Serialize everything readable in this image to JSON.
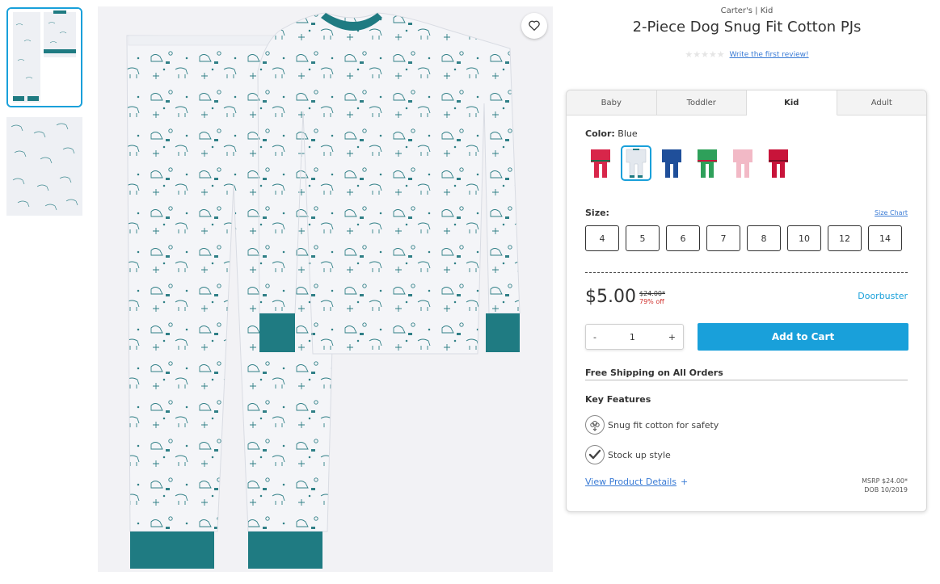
{
  "product": {
    "brand": "Carter's | Kid",
    "title": "2-Piece Dog Snug Fit Cotton PJs",
    "rating_stars": "★★★★★",
    "review_link": "Write the first review!"
  },
  "gallery": {
    "thumbnails": [
      "pajama-set-thumbnail",
      "fabric-detail-thumbnail"
    ],
    "fav_icon": "heart-icon"
  },
  "tabs": [
    {
      "label": "Baby",
      "active": false
    },
    {
      "label": "Toddler",
      "active": false
    },
    {
      "label": "Kid",
      "active": true
    },
    {
      "label": "Adult",
      "active": false
    }
  ],
  "color": {
    "label": "Color:",
    "value": "Blue",
    "swatches": [
      {
        "name": "red-print",
        "color": "#d8264a",
        "selected": false
      },
      {
        "name": "blue-dog",
        "color": "#e8edf2",
        "selected": true
      },
      {
        "name": "navy",
        "color": "#1f4f9a",
        "selected": false
      },
      {
        "name": "green",
        "color": "#2ea05a",
        "selected": false
      },
      {
        "name": "pink",
        "color": "#f2b9c6",
        "selected": false
      },
      {
        "name": "red",
        "color": "#c8143a",
        "selected": false
      }
    ]
  },
  "size": {
    "label": "Size:",
    "chart_link": "Size Chart",
    "options": [
      "4",
      "5",
      "6",
      "7",
      "8",
      "10",
      "12",
      "14"
    ]
  },
  "price": {
    "current": "$5.00",
    "original": "$24.00*",
    "discount": "79% off",
    "badge": "Doorbuster"
  },
  "cart": {
    "minus": "-",
    "quantity": "1",
    "plus": "+",
    "add_label": "Add to Cart"
  },
  "shipping": "Free Shipping on All Orders",
  "features": {
    "title": "Key Features",
    "items": [
      {
        "label": "Snug fit cotton for safety",
        "icon": "cotton-flower-icon"
      },
      {
        "label": "Stock up style",
        "icon": "checkmark-icon"
      }
    ]
  },
  "details": {
    "link": "View Product Details",
    "plus": "+",
    "msrp": "MSRP $24.00*",
    "dob": "DOB 10/2019"
  },
  "colors": {
    "accent": "#19a0da",
    "link": "#3a7bd5",
    "sale_red": "#d0312d",
    "trim_teal": "#1f7b82"
  }
}
